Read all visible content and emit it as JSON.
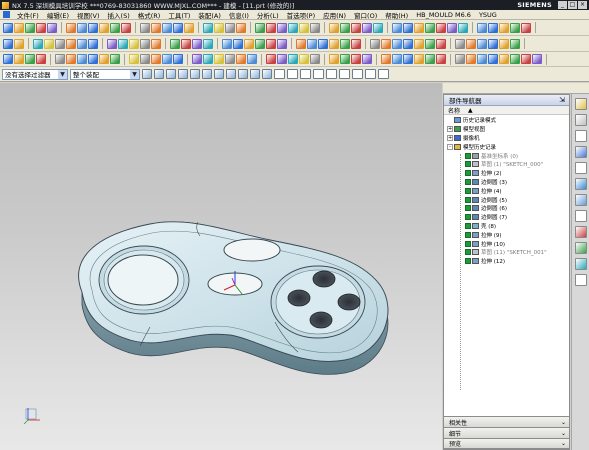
{
  "window": {
    "app": "NX 7.5",
    "title": "NX 7.5 深圳模具培训学校 ***0769-83031860 WWW.MJXL.COM*** - 建模 - [11.prt (修改的)]",
    "brand": "SIEMENS",
    "buttons": [
      "_",
      "□",
      "×"
    ]
  },
  "menu": [
    "文件(F)",
    "编辑(E)",
    "视图(V)",
    "插入(S)",
    "格式(R)",
    "工具(T)",
    "装配(A)",
    "信息(I)",
    "分析(L)",
    "首选项(P)",
    "应用(N)",
    "窗口(O)",
    "帮助(H)",
    "HB_MOULD M6.6",
    "YSUG"
  ],
  "selection_bar": {
    "filter_value": "没有选择过滤器",
    "assembly_value": "整个装配"
  },
  "navigator": {
    "title": "部件导航器",
    "pin": "⇲",
    "column_header": "名称",
    "sort_icon": "▲",
    "nodes": [
      {
        "label": "历史记录模式",
        "type": "mode",
        "level": 0,
        "expand": "",
        "dim": false
      },
      {
        "label": "模型视图",
        "type": "view",
        "level": 0,
        "expand": "+",
        "dim": false
      },
      {
        "label": "摄像机",
        "type": "camera",
        "level": 0,
        "expand": "+",
        "dim": false
      },
      {
        "label": "模型历史记录",
        "type": "folder",
        "level": 0,
        "expand": "-",
        "dim": false
      },
      {
        "label": "基准坐标系 (0)",
        "type": "datum",
        "level": 1,
        "dim": true
      },
      {
        "label": "草图 (1) \"SKETCH_000\"",
        "type": "sketch",
        "level": 1,
        "dim": true
      },
      {
        "label": "拉伸 (2)",
        "type": "extrude",
        "level": 1,
        "dim": false
      },
      {
        "label": "边倒圆 (3)",
        "type": "blend",
        "level": 1,
        "dim": false
      },
      {
        "label": "拉伸 (4)",
        "type": "extrude",
        "level": 1,
        "dim": false
      },
      {
        "label": "边倒圆 (5)",
        "type": "blend",
        "level": 1,
        "dim": false
      },
      {
        "label": "边倒圆 (6)",
        "type": "blend",
        "level": 1,
        "dim": false
      },
      {
        "label": "边倒圆 (7)",
        "type": "blend",
        "level": 1,
        "dim": false
      },
      {
        "label": "壳 (8)",
        "type": "shell",
        "level": 1,
        "dim": false
      },
      {
        "label": "拉伸 (9)",
        "type": "extrude",
        "level": 1,
        "dim": false
      },
      {
        "label": "拉伸 (10)",
        "type": "extrude",
        "level": 1,
        "dim": false
      },
      {
        "label": "草图 (11) \"SKETCH_001\"",
        "type": "sketch",
        "level": 1,
        "dim": true
      },
      {
        "label": "拉伸 (12)",
        "type": "extrude",
        "level": 1,
        "dim": false
      }
    ],
    "bottom_panels": [
      "相关性",
      "细节",
      "预览"
    ]
  },
  "colors": {
    "titlebar": "#1b1e24",
    "model_body": "#cfe3ea",
    "model_edge": "#3a4a55",
    "check_green": "#1f9a3a",
    "viewport_top": "#bcbcbc",
    "viewport_bottom": "#e8e8e8"
  }
}
